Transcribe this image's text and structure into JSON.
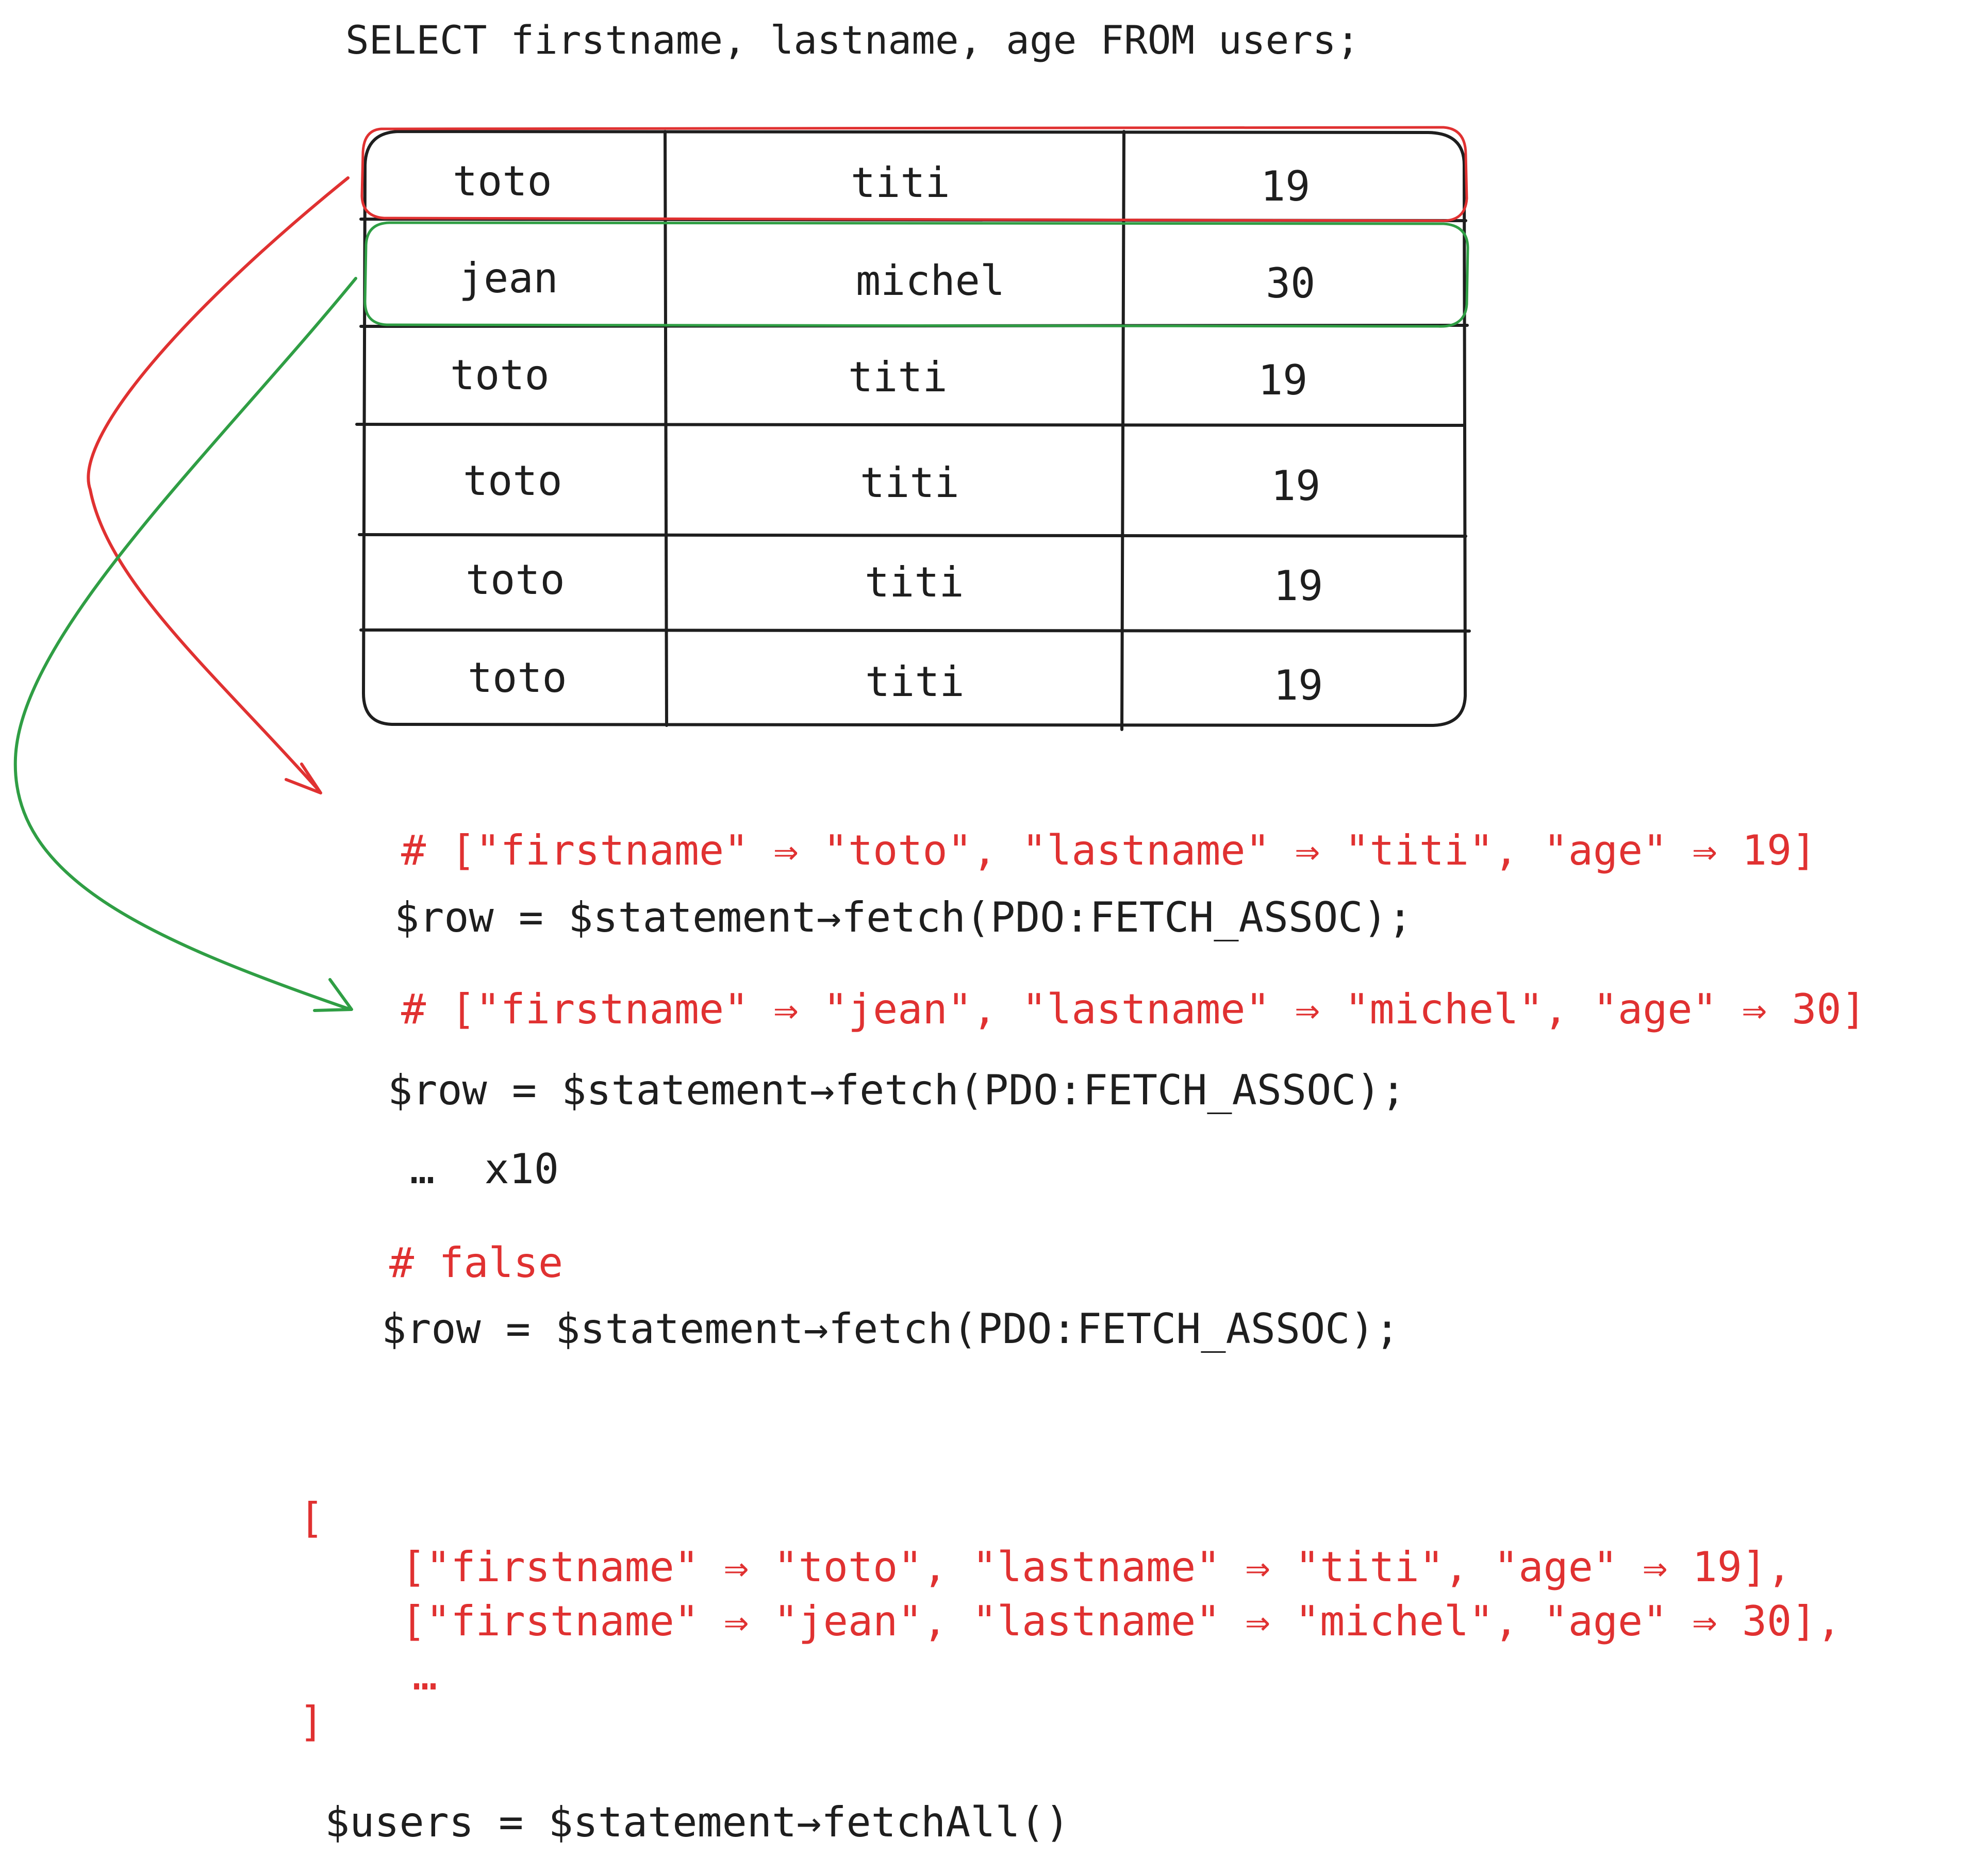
{
  "colors": {
    "ink": "#1e1e1e",
    "first_row_highlight": "#e03131",
    "second_row_highlight": "#2f9e44"
  },
  "query": "SELECT firstname, lastname, age FROM users;",
  "table": {
    "rows": [
      [
        "toto",
        "titi",
        "19"
      ],
      [
        "jean",
        "michel",
        "30"
      ],
      [
        "toto",
        "titi",
        "19"
      ],
      [
        "toto",
        "titi",
        "19"
      ],
      [
        "toto",
        "titi",
        "19"
      ],
      [
        "toto",
        "titi",
        "19"
      ]
    ]
  },
  "fetch_steps": {
    "first_comment": "# [\"firstname\" ⇒ \"toto\", \"lastname\" ⇒ \"titi\", \"age\" ⇒ 19]",
    "first_code": "$row = $statement→fetch(PDO:FETCH_ASSOC);",
    "second_comment": "# [\"firstname\" ⇒ \"jean\", \"lastname\" ⇒ \"michel\", \"age\" ⇒ 30]",
    "second_code": "$row = $statement→fetch(PDO:FETCH_ASSOC);",
    "repeat_note": "…  x10",
    "final_comment": "# false",
    "final_code": "$row = $statement→fetch(PDO:FETCH_ASSOC);"
  },
  "fetch_all": {
    "open_bracket": "[",
    "line_1": "[\"firstname\" ⇒ \"toto\", \"lastname\" ⇒ \"titi\", \"age\" ⇒ 19],",
    "line_2": "[\"firstname\" ⇒ \"jean\", \"lastname\" ⇒ \"michel\", \"age\" ⇒ 30],",
    "ellipsis": "…",
    "close_bracket": "]",
    "code": "$users = $statement→fetchAll()"
  }
}
